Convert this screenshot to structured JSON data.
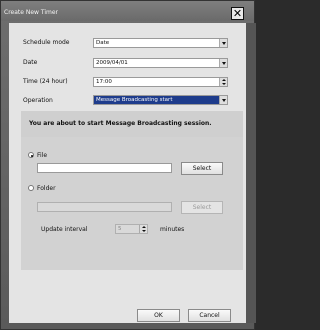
{
  "window": {
    "title": "Create New Timer"
  },
  "form": {
    "schedule_mode": {
      "label": "Schedule mode",
      "value": "Date"
    },
    "date": {
      "label": "Date",
      "value": "2009/04/01"
    },
    "time": {
      "label": "Time (24 hour)",
      "value": "17:00"
    },
    "operation": {
      "label": "Operation",
      "value": "Message Broadcasting start"
    }
  },
  "notice": "You are about to start Message Broadcasting session.",
  "source": {
    "file": {
      "label": "File",
      "value": "",
      "button": "Select",
      "selected": true
    },
    "folder": {
      "label": "Folder",
      "value": "",
      "button": "Select",
      "selected": false
    },
    "update_interval": {
      "label": "Update interval",
      "value": "5",
      "unit": "minutes"
    }
  },
  "buttons": {
    "ok": "OK",
    "cancel": "Cancel"
  }
}
